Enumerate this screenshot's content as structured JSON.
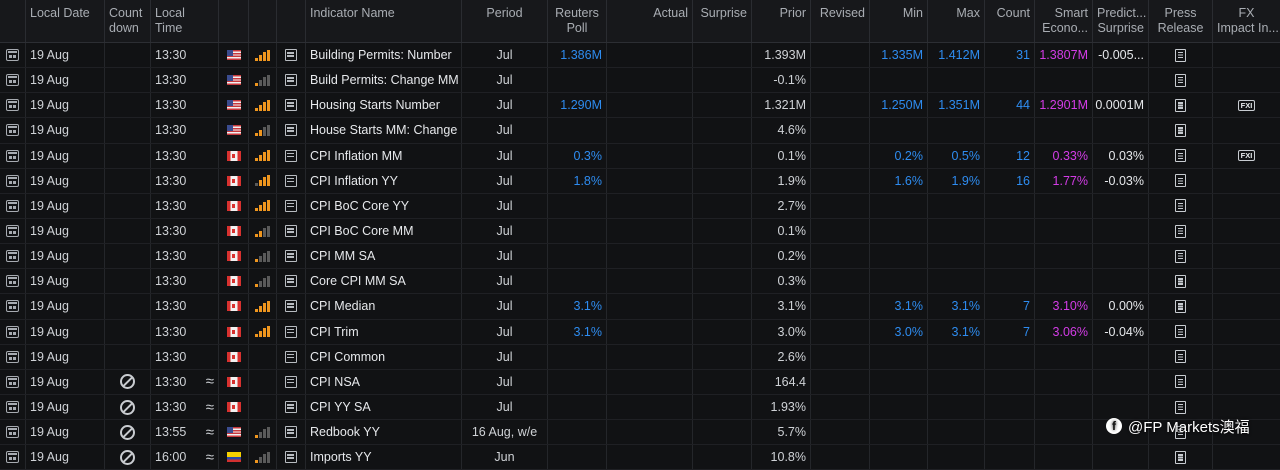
{
  "headers": {
    "local_date": "Local Date",
    "countdown_1": "Count",
    "countdown_2": "down",
    "local_time_1": "Local",
    "local_time_2": "Time",
    "indicator": "Indicator Name",
    "period": "Period",
    "poll_1": "Reuters",
    "poll_2": "Poll",
    "actual": "Actual",
    "surprise": "Surprise",
    "prior": "Prior",
    "revised": "Revised",
    "min": "Min",
    "max": "Max",
    "count": "Count",
    "smart_1": "Smart",
    "smart_2": "Econo...",
    "pred_1": "Predict...",
    "pred_2": "Surprise",
    "press_1": "Press",
    "press_2": "Release",
    "fx_1": "FX",
    "fx_2": "Impact In..."
  },
  "rows": [
    {
      "date": "19 Aug",
      "countdown": false,
      "time": "13:30",
      "approx": false,
      "flag": "us",
      "bars": "b-or",
      "indicator": "Building Permits: Number",
      "period": "Jul",
      "poll": "1.386M",
      "actual": "",
      "surprise": "",
      "prior": "1.393M",
      "revised": "",
      "min": "1.335M",
      "max": "1.412M",
      "count": "31",
      "smart": "1.3807M",
      "pred": "-0.005...",
      "fx": false
    },
    {
      "date": "19 Aug",
      "countdown": false,
      "time": "13:30",
      "approx": false,
      "flag": "us",
      "bars": "b-gray",
      "indicator": "Build Permits: Change MM",
      "period": "Jul",
      "poll": "",
      "actual": "",
      "surprise": "",
      "prior": "-0.1%",
      "revised": "",
      "min": "",
      "max": "",
      "count": "",
      "smart": "",
      "pred": "",
      "fx": false
    },
    {
      "date": "19 Aug",
      "countdown": false,
      "time": "13:30",
      "approx": false,
      "flag": "us",
      "bars": "b-or",
      "indicator": "Housing Starts Number",
      "period": "Jul",
      "poll": "1.290M",
      "actual": "",
      "surprise": "",
      "prior": "1.321M",
      "revised": "",
      "min": "1.250M",
      "max": "1.351M",
      "count": "44",
      "smart": "1.2901M",
      "pred": "0.0001M",
      "fx": true,
      "fx_label": "FXI"
    },
    {
      "date": "19 Aug",
      "countdown": false,
      "time": "13:30",
      "approx": false,
      "flag": "us",
      "bars": "b-orlow",
      "indicator": "House Starts MM: Change",
      "period": "Jul",
      "poll": "",
      "actual": "",
      "surprise": "",
      "prior": "4.6%",
      "revised": "",
      "min": "",
      "max": "",
      "count": "",
      "smart": "",
      "pred": "",
      "fx": false
    },
    {
      "date": "19 Aug",
      "countdown": false,
      "time": "13:30",
      "approx": false,
      "flag": "ca",
      "bars": "b-or",
      "indicator": "CPI Inflation MM",
      "period": "Jul",
      "poll": "0.3%",
      "actual": "",
      "surprise": "",
      "prior": "0.1%",
      "revised": "",
      "min": "0.2%",
      "max": "0.5%",
      "count": "12",
      "smart": "0.33%",
      "pred": "0.03%",
      "fx": true,
      "fx_label": "FXI"
    },
    {
      "date": "19 Aug",
      "countdown": false,
      "time": "13:30",
      "approx": false,
      "flag": "ca",
      "bars": "b-orhigh",
      "indicator": "CPI Inflation YY",
      "period": "Jul",
      "poll": "1.8%",
      "actual": "",
      "surprise": "",
      "prior": "1.9%",
      "revised": "",
      "min": "1.6%",
      "max": "1.9%",
      "count": "16",
      "smart": "1.77%",
      "pred": "-0.03%",
      "fx": false
    },
    {
      "date": "19 Aug",
      "countdown": false,
      "time": "13:30",
      "approx": false,
      "flag": "ca",
      "bars": "b-or",
      "indicator": "CPI BoC Core YY",
      "period": "Jul",
      "poll": "",
      "actual": "",
      "surprise": "",
      "prior": "2.7%",
      "revised": "",
      "min": "",
      "max": "",
      "count": "",
      "smart": "",
      "pred": "",
      "fx": false
    },
    {
      "date": "19 Aug",
      "countdown": false,
      "time": "13:30",
      "approx": false,
      "flag": "ca",
      "bars": "b-orlow",
      "indicator": "CPI BoC Core MM",
      "period": "Jul",
      "poll": "",
      "actual": "",
      "surprise": "",
      "prior": "0.1%",
      "revised": "",
      "min": "",
      "max": "",
      "count": "",
      "smart": "",
      "pred": "",
      "fx": false
    },
    {
      "date": "19 Aug",
      "countdown": false,
      "time": "13:30",
      "approx": false,
      "flag": "ca",
      "bars": "b-gray",
      "indicator": "CPI MM SA",
      "period": "Jul",
      "poll": "",
      "actual": "",
      "surprise": "",
      "prior": "0.2%",
      "revised": "",
      "min": "",
      "max": "",
      "count": "",
      "smart": "",
      "pred": "",
      "fx": false
    },
    {
      "date": "19 Aug",
      "countdown": false,
      "time": "13:30",
      "approx": false,
      "flag": "ca",
      "bars": "b-gray",
      "indicator": "Core CPI MM SA",
      "period": "Jul",
      "poll": "",
      "actual": "",
      "surprise": "",
      "prior": "0.3%",
      "revised": "",
      "min": "",
      "max": "",
      "count": "",
      "smart": "",
      "pred": "",
      "fx": false
    },
    {
      "date": "19 Aug",
      "countdown": false,
      "time": "13:30",
      "approx": false,
      "flag": "ca",
      "bars": "b-or",
      "indicator": "CPI Median",
      "period": "Jul",
      "poll": "3.1%",
      "actual": "",
      "surprise": "",
      "prior": "3.1%",
      "revised": "",
      "min": "3.1%",
      "max": "3.1%",
      "count": "7",
      "smart": "3.10%",
      "pred": "0.00%",
      "fx": false
    },
    {
      "date": "19 Aug",
      "countdown": false,
      "time": "13:30",
      "approx": false,
      "flag": "ca",
      "bars": "b-or",
      "indicator": "CPI Trim",
      "period": "Jul",
      "poll": "3.1%",
      "actual": "",
      "surprise": "",
      "prior": "3.0%",
      "revised": "",
      "min": "3.0%",
      "max": "3.1%",
      "count": "7",
      "smart": "3.06%",
      "pred": "-0.04%",
      "fx": false
    },
    {
      "date": "19 Aug",
      "countdown": false,
      "time": "13:30",
      "approx": false,
      "flag": "ca",
      "bars": "",
      "indicator": "CPI Common",
      "period": "Jul",
      "poll": "",
      "actual": "",
      "surprise": "",
      "prior": "2.6%",
      "revised": "",
      "min": "",
      "max": "",
      "count": "",
      "smart": "",
      "pred": "",
      "fx": false
    },
    {
      "date": "19 Aug",
      "countdown": true,
      "time": "13:30",
      "approx": true,
      "flag": "ca",
      "bars": "",
      "indicator": "CPI NSA",
      "period": "Jul",
      "poll": "",
      "actual": "",
      "surprise": "",
      "prior": "164.4",
      "revised": "",
      "min": "",
      "max": "",
      "count": "",
      "smart": "",
      "pred": "",
      "fx": false
    },
    {
      "date": "19 Aug",
      "countdown": true,
      "time": "13:30",
      "approx": true,
      "flag": "ca",
      "bars": "",
      "indicator": "CPI YY SA",
      "period": "Jul",
      "poll": "",
      "actual": "",
      "surprise": "",
      "prior": "1.93%",
      "revised": "",
      "min": "",
      "max": "",
      "count": "",
      "smart": "",
      "pred": "",
      "fx": false
    },
    {
      "date": "19 Aug",
      "countdown": true,
      "time": "13:55",
      "approx": true,
      "flag": "us",
      "bars": "b-gray",
      "indicator": "Redbook YY",
      "period": "16 Aug, w/e",
      "poll": "",
      "actual": "",
      "surprise": "",
      "prior": "5.7%",
      "revised": "",
      "min": "",
      "max": "",
      "count": "",
      "smart": "",
      "pred": "",
      "fx": false
    },
    {
      "date": "19 Aug",
      "countdown": true,
      "time": "16:00",
      "approx": true,
      "flag": "co",
      "bars": "b-gray",
      "indicator": "Imports YY",
      "period": "Jun",
      "poll": "",
      "actual": "",
      "surprise": "",
      "prior": "10.8%",
      "revised": "",
      "min": "",
      "max": "",
      "count": "",
      "smart": "",
      "pred": "",
      "fx": false
    }
  ],
  "watermark": "@FP Markets澳福"
}
